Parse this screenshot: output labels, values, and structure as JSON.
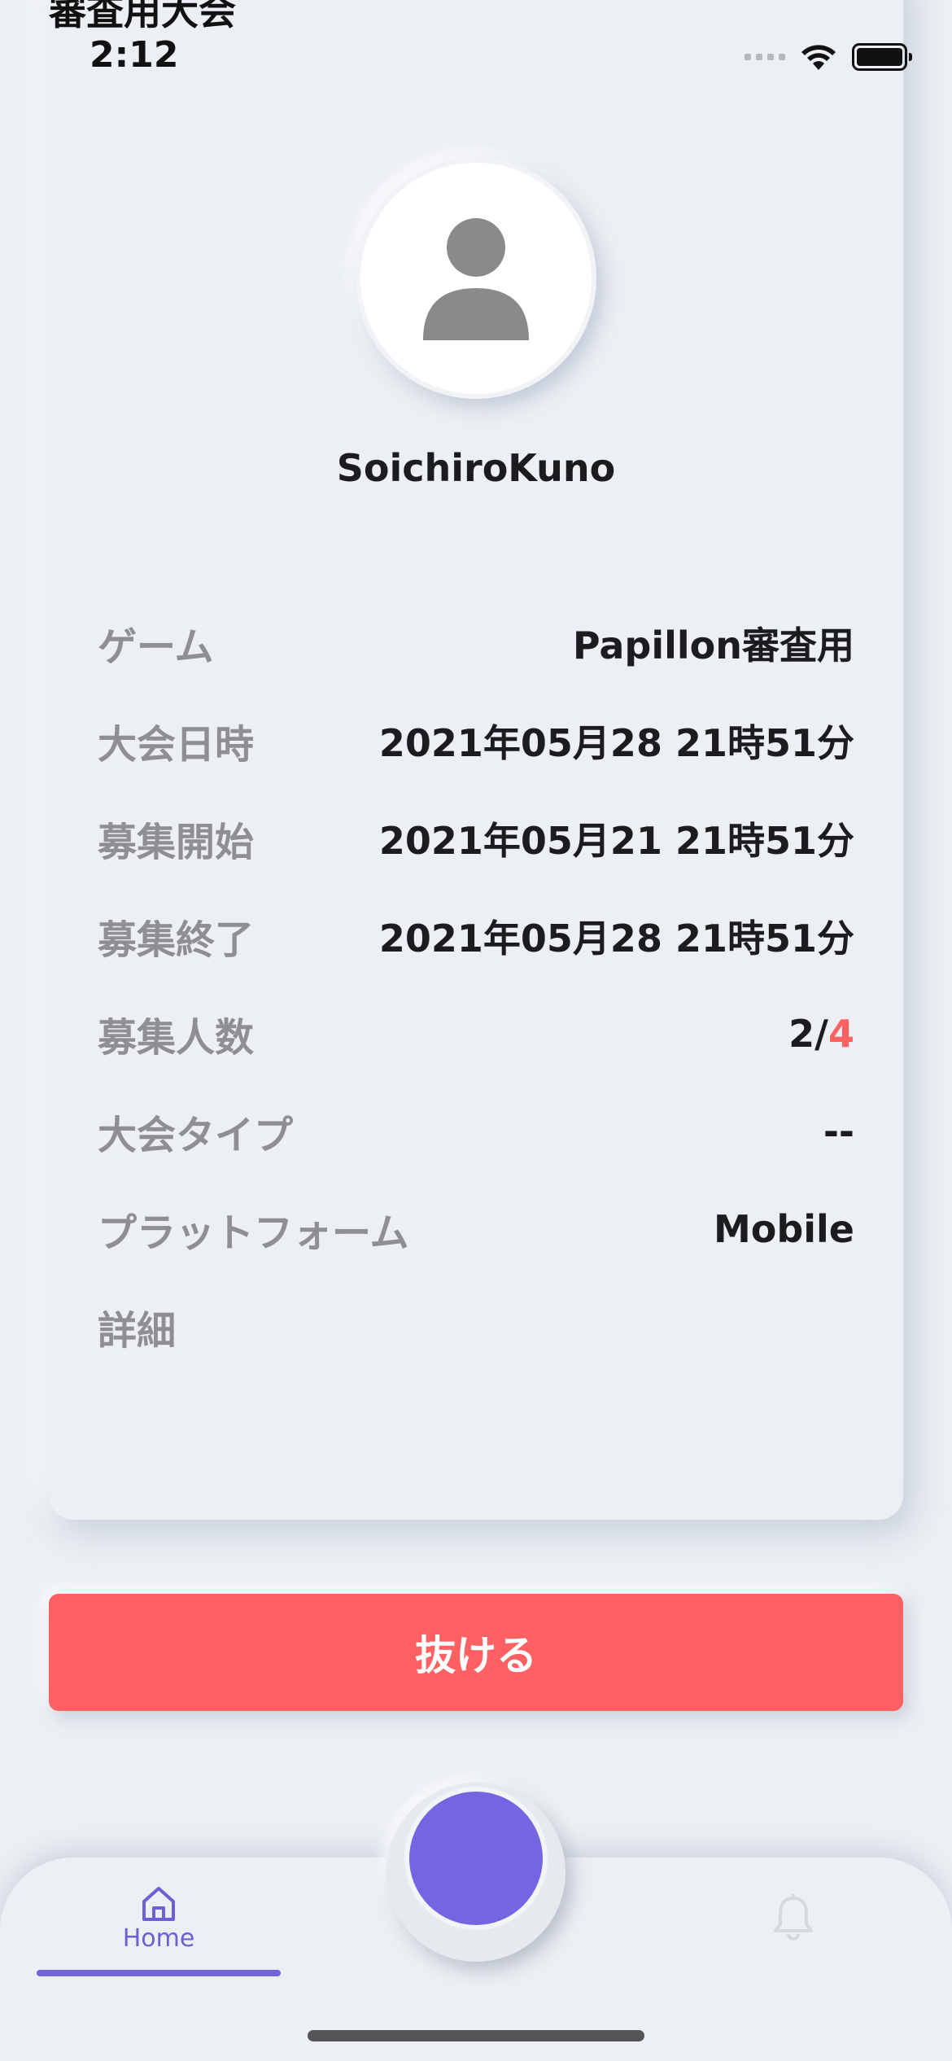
{
  "status_bar": {
    "time": "2:12"
  },
  "card": {
    "title": "審査用大会",
    "username": "SoichiroKuno",
    "rows": [
      {
        "label": "ゲーム",
        "value": "Papillon審査用"
      },
      {
        "label": "大会日時",
        "value": "2021年05月28 21時51分"
      },
      {
        "label": "募集開始",
        "value": "2021年05月21 21時51分"
      },
      {
        "label": "募集終了",
        "value": "2021年05月28 21時51分"
      },
      {
        "label": "募集人数",
        "value_current": "2/",
        "value_max": "4"
      },
      {
        "label": "大会タイプ",
        "value": "--"
      },
      {
        "label": "プラットフォーム",
        "value": "Mobile"
      },
      {
        "label": "詳細",
        "value": ""
      }
    ]
  },
  "leave_button": {
    "label": "抜ける"
  },
  "tab_bar": {
    "home_label": "Home",
    "active_tab": "home",
    "icons": [
      "home-icon",
      "bell-icon"
    ]
  },
  "colors": {
    "background": "#eceff3",
    "accent_purple": "#7565e0",
    "danger_red": "#ff6163",
    "label_gray": "#8e8e93"
  }
}
